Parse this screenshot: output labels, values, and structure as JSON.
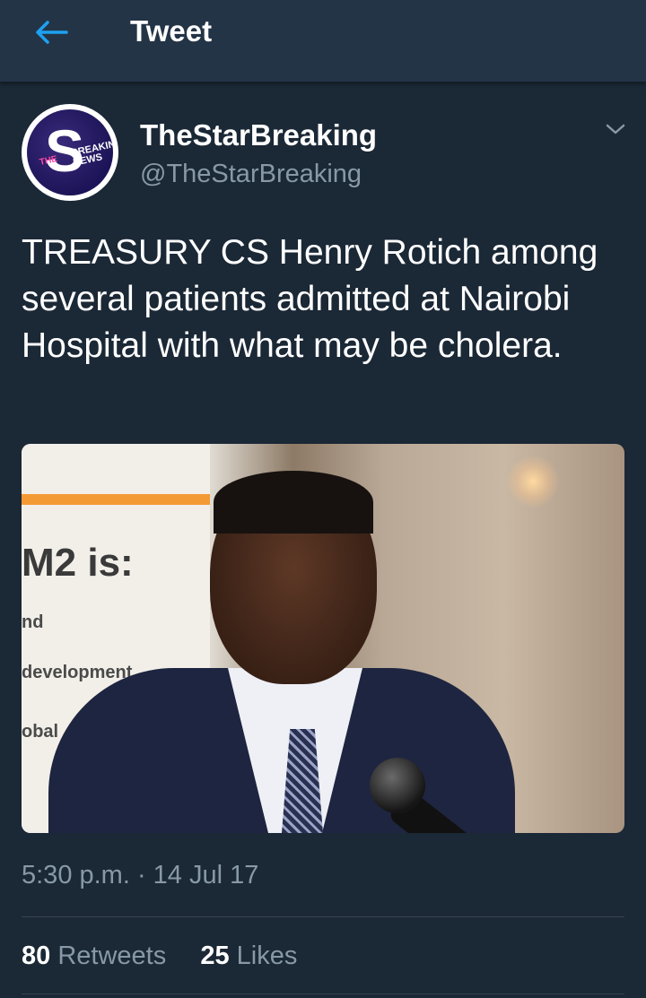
{
  "header": {
    "title": "Tweet",
    "back_icon": "arrow-left-icon",
    "accent_color": "#1da1f2"
  },
  "tweet": {
    "author_name": "TheStarBreaking",
    "author_handle": "@TheStarBreaking",
    "avatar_text": {
      "letter": "S",
      "breaking": "BREAKING",
      "news": "NEWS",
      "the": "THE"
    },
    "menu_icon": "chevron-down-icon",
    "text": "TREASURY CS Henry Rotich among several patients admitted at Nairobi Hospital with what may be cholera.",
    "media": {
      "banner_lines": [
        "M2 is:",
        "nd",
        "development",
        "obal"
      ]
    },
    "timestamp": "5:30 p.m. · 14 Jul 17"
  },
  "stats": {
    "retweets_count": "80",
    "retweets_label": "Retweets",
    "likes_count": "25",
    "likes_label": "Likes"
  }
}
